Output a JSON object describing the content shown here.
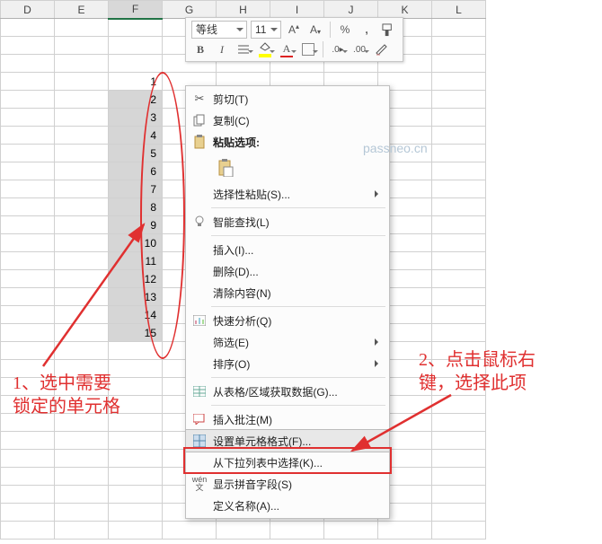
{
  "columns": [
    "D",
    "E",
    "F",
    "G",
    "H",
    "I",
    "J",
    "K",
    "L"
  ],
  "active_col": "F",
  "selection_values": [
    1,
    2,
    3,
    4,
    5,
    6,
    7,
    8,
    9,
    10,
    11,
    12,
    13,
    14,
    15
  ],
  "watermark": "passneo.cn",
  "mini_toolbar": {
    "font_name": "等线",
    "font_size": "11"
  },
  "context_menu": {
    "cut": "剪切(T)",
    "copy": "复制(C)",
    "paste_options": "粘贴选项:",
    "paste_special": "选择性粘贴(S)...",
    "smart_lookup": "智能查找(L)",
    "insert": "插入(I)...",
    "delete": "删除(D)...",
    "clear": "清除内容(N)",
    "quick_analysis": "快速分析(Q)",
    "filter": "筛选(E)",
    "sort": "排序(O)",
    "get_from_table": "从表格/区域获取数据(G)...",
    "insert_comment": "插入批注(M)",
    "format_cells": "设置单元格格式(F)...",
    "pick_from_list": "从下拉列表中选择(K)...",
    "show_pinyin": "显示拼音字段(S)",
    "define_name": "定义名称(A)..."
  },
  "annotations": {
    "left": "1、选中需要\n锁定的单元格",
    "right": "2、点击鼠标右\n键，选择此项"
  }
}
